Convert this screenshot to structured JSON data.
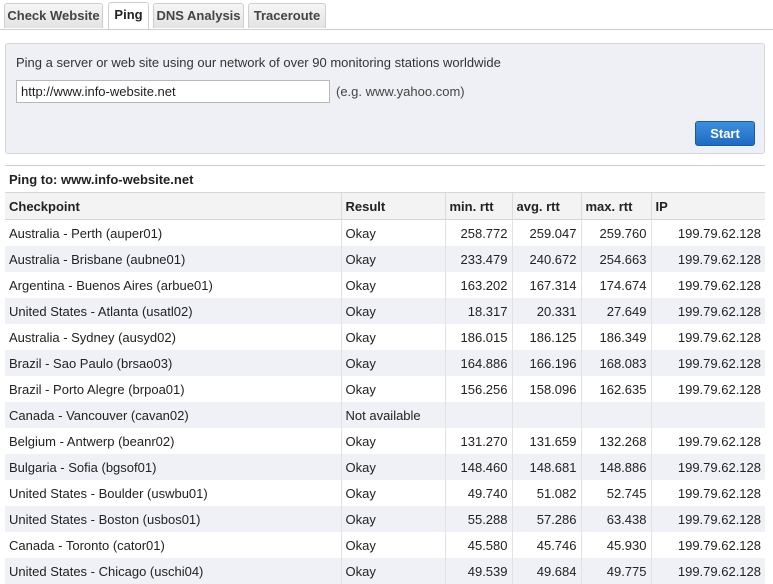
{
  "tabs": [
    {
      "label": "Check Website",
      "active": false
    },
    {
      "label": "Ping",
      "active": true
    },
    {
      "label": "DNS Analysis",
      "active": false
    },
    {
      "label": "Traceroute",
      "active": false
    }
  ],
  "search": {
    "description": "Ping a server or web site using our network of over 90 monitoring stations worldwide",
    "value": "http://www.info-website.net",
    "example": "(e.g. www.yahoo.com)",
    "start_label": "Start"
  },
  "results": {
    "title": "Ping to: www.info-website.net",
    "columns": [
      "Checkpoint",
      "Result",
      "min. rtt",
      "avg. rtt",
      "max. rtt",
      "IP"
    ],
    "rows": [
      [
        "Australia - Perth (auper01)",
        "Okay",
        "258.772",
        "259.047",
        "259.760",
        "199.79.62.128"
      ],
      [
        "Australia - Brisbane (aubne01)",
        "Okay",
        "233.479",
        "240.672",
        "254.663",
        "199.79.62.128"
      ],
      [
        "Argentina - Buenos Aires (arbue01)",
        "Okay",
        "163.202",
        "167.314",
        "174.674",
        "199.79.62.128"
      ],
      [
        "United States - Atlanta (usatl02)",
        "Okay",
        "18.317",
        "20.331",
        "27.649",
        "199.79.62.128"
      ],
      [
        "Australia - Sydney (ausyd02)",
        "Okay",
        "186.015",
        "186.125",
        "186.349",
        "199.79.62.128"
      ],
      [
        "Brazil - Sao Paulo (brsao03)",
        "Okay",
        "164.886",
        "166.196",
        "168.083",
        "199.79.62.128"
      ],
      [
        "Brazil - Porto Alegre (brpoa01)",
        "Okay",
        "156.256",
        "158.096",
        "162.635",
        "199.79.62.128"
      ],
      [
        "Canada - Vancouver (cavan02)",
        "Not available",
        "",
        "",
        "",
        ""
      ],
      [
        "Belgium - Antwerp (beanr02)",
        "Okay",
        "131.270",
        "131.659",
        "132.268",
        "199.79.62.128"
      ],
      [
        "Bulgaria - Sofia (bgsof01)",
        "Okay",
        "148.460",
        "148.681",
        "148.886",
        "199.79.62.128"
      ],
      [
        "United States - Boulder (uswbu01)",
        "Okay",
        "49.740",
        "51.082",
        "52.745",
        "199.79.62.128"
      ],
      [
        "United States - Boston (usbos01)",
        "Okay",
        "55.288",
        "57.286",
        "63.438",
        "199.79.62.128"
      ],
      [
        "Canada - Toronto (cator01)",
        "Okay",
        "45.580",
        "45.746",
        "45.930",
        "199.79.62.128"
      ],
      [
        "United States - Chicago (uschi04)",
        "Okay",
        "49.539",
        "49.684",
        "49.775",
        "199.79.62.128"
      ]
    ]
  },
  "colors": {
    "panel_bg": "#eef0f5",
    "row_alt": "#f0f1f6",
    "button": "#2a7bd0"
  }
}
